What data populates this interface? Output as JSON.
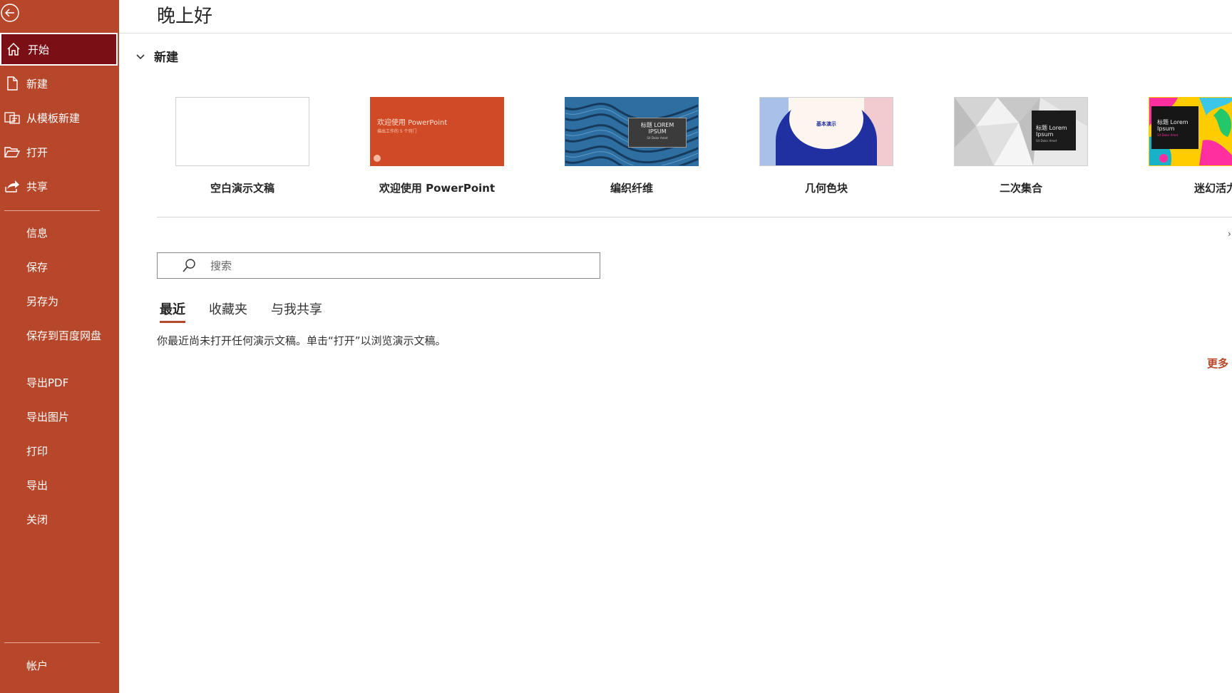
{
  "app": {
    "accent": "#b7472a",
    "sidebar_active_bg": "#7a0f15"
  },
  "sidebar": {
    "back_icon": "back-arrow-icon",
    "primary": [
      {
        "label": "开始",
        "icon": "home-icon",
        "active": true
      },
      {
        "label": "新建",
        "icon": "new-document-icon"
      },
      {
        "label": "从模板新建",
        "icon": "template-icon"
      },
      {
        "label": "打开",
        "icon": "folder-open-icon"
      },
      {
        "label": "共享",
        "icon": "share-icon"
      }
    ],
    "secondary": [
      {
        "label": "信息"
      },
      {
        "label": "保存"
      },
      {
        "label": "另存为"
      },
      {
        "label": "保存到百度网盘"
      },
      {
        "label": "导出PDF"
      },
      {
        "label": "导出图片"
      },
      {
        "label": "打印"
      },
      {
        "label": "导出"
      },
      {
        "label": "关闭"
      }
    ],
    "account": {
      "label": "帐户"
    }
  },
  "main": {
    "greeting": "晚上好",
    "new_section": {
      "label": "新建",
      "toggle_icon": "chevron-down-icon"
    },
    "templates": [
      {
        "name": "空白演示文稿"
      },
      {
        "name": "欢迎使用 PowerPoint",
        "thumb_title": "欢迎使用 PowerPoint",
        "thumb_sub": "描出工作的 5 个窍门"
      },
      {
        "name": "编织纤维",
        "thumb_title": "标题 LOREM IPSUM",
        "thumb_sub": "Sit Dolor Amet"
      },
      {
        "name": "几何色块",
        "thumb_title": "基本演示"
      },
      {
        "name": "二次集合",
        "thumb_title": "标题 Lorem Ipsum",
        "thumb_sub": "Sit Dolor Amet"
      },
      {
        "name": "迷幻活力",
        "thumb_title": "标题 Lorem Ipsum",
        "thumb_sub": "Sit Dolor Amet"
      }
    ],
    "search": {
      "placeholder": "搜索",
      "icon": "search-icon"
    },
    "tabs": [
      {
        "label": "最近",
        "active": true
      },
      {
        "label": "收藏夹"
      },
      {
        "label": "与我共享"
      }
    ],
    "empty_message": "你最近尚未打开任何演示文稿。单击“打开”以浏览演示文稿。",
    "more_link": "更多"
  }
}
